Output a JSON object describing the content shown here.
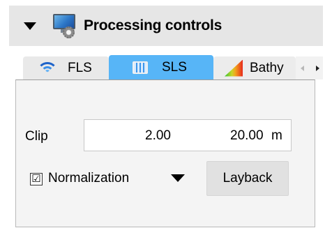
{
  "header": {
    "title": "Processing controls",
    "collapse_icon": "triangle-down-icon",
    "app_icon": "monitor-gear-icon"
  },
  "tabs": [
    {
      "label": "FLS",
      "icon": "wifi-icon",
      "selected": false
    },
    {
      "label": "SLS",
      "icon": "sls-icon",
      "selected": true
    },
    {
      "label": "Bathy",
      "icon": "bathy-gradient-icon",
      "selected": false
    }
  ],
  "panel": {
    "clip": {
      "label": "Clip",
      "min": "2.00",
      "max": "20.00",
      "unit": "m"
    },
    "normalization": {
      "label": "Normalization",
      "checked": true,
      "check_mark": "☑"
    },
    "layback": {
      "label": "Layback"
    }
  },
  "colors": {
    "header_bg": "#e6e6e6",
    "selected_tab": "#57b5f7",
    "panel_bg": "#f4f4f4"
  }
}
